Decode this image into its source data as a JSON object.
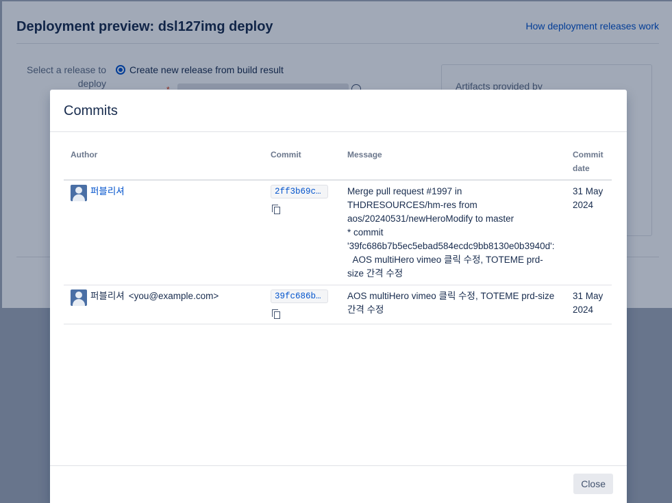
{
  "background": {
    "page_title": "Deployment preview: dsl127img deploy",
    "help_link": "How deployment releases work",
    "release_label": "Select a release to deploy",
    "radio_option": "Create new release from build result",
    "required_marker": "*",
    "artifacts_label": "Artifacts provided by"
  },
  "modal": {
    "title": "Commits",
    "columns": {
      "author": "Author",
      "commit": "Commit",
      "message": "Message",
      "date": "Commit date"
    },
    "rows": [
      {
        "author": "퍼블리셔",
        "email": "",
        "hash": "2ff3b69c…",
        "message": "Merge pull request #1997 in THDRESOURCES/hm-res from aos/20240531/newHeroModify to master\n* commit '39fc686b7b5ec5ebad584ecdc9bb8130e0b3940d':\n  AOS multiHero vimeo 클릭 수정, TOTEME prd-size 간격 수정",
        "date": "31 May 2024"
      },
      {
        "author": "퍼블리셔",
        "email": "<you@example.com>",
        "hash": "39fc686b…",
        "message": "AOS multiHero vimeo 클릭 수정, TOTEME prd-size 간격 수정",
        "date": "31 May 2024"
      }
    ],
    "close_label": "Close"
  }
}
